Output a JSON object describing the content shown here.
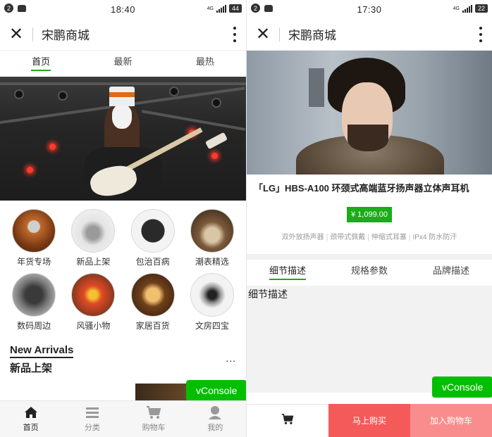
{
  "left": {
    "status": {
      "notif": "2",
      "time": "18:40",
      "net": "4G",
      "battery": "44"
    },
    "app_title": "宋鹏商城",
    "tabs": [
      "首页",
      "最新",
      "最热"
    ],
    "categories": [
      {
        "label": "年货专场",
        "icon": "coffee-dripper-photo"
      },
      {
        "label": "新品上架",
        "icon": "espresso-machine-photo"
      },
      {
        "label": "包治百病",
        "icon": "black-box-photo"
      },
      {
        "label": "潮表精选",
        "icon": "coffee-cup-photo"
      },
      {
        "label": "数码周边",
        "icon": "coffee-roaster-photo"
      },
      {
        "label": "风骚小物",
        "icon": "kitchen-scale-photo"
      },
      {
        "label": "家居百货",
        "icon": "espresso-shots-photo"
      },
      {
        "label": "文房四宝",
        "icon": "aeropress-photo"
      }
    ],
    "section": {
      "title_en": "New Arrivals",
      "title_cn": "新品上架",
      "more": "..."
    },
    "vconsole": "vConsole",
    "nav": [
      {
        "label": "首页",
        "icon": "home-icon"
      },
      {
        "label": "分类",
        "icon": "list-icon"
      },
      {
        "label": "购物车",
        "icon": "cart-icon"
      },
      {
        "label": "我的",
        "icon": "user-icon"
      }
    ]
  },
  "right": {
    "status": {
      "notif": "2",
      "time": "17:30",
      "net": "4G",
      "battery": "22"
    },
    "app_title": "宋鹏商城",
    "product": {
      "name": "「LG」HBS-A100 环颈式高端蓝牙扬声器立体声耳机",
      "price": "¥ 1,099.00",
      "tags": [
        "双外放扬声器",
        "颈带式佩戴",
        "伸缩式耳塞",
        "IPx4 防水防汗"
      ]
    },
    "tabs": [
      "细节描述",
      "规格参数",
      "品牌描述"
    ],
    "detail_text": "细节描述",
    "vconsole": "vConsole",
    "buy_now": "马上购买",
    "add_to_cart": "加入购物车"
  },
  "colors": {
    "accent": "#1aad19",
    "vconsole": "#04be02",
    "buy": "#f45a5a",
    "add": "#f98d8d"
  }
}
